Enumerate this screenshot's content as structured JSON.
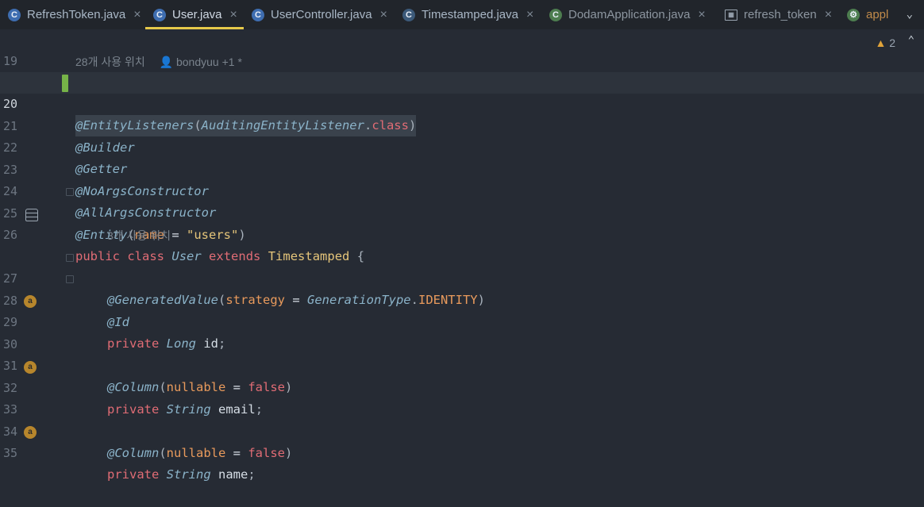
{
  "tabs": [
    {
      "label": "RefreshToken.java",
      "icon": "class-icon",
      "icon_glyph": "C",
      "active": false
    },
    {
      "label": "User.java",
      "icon": "class-icon",
      "icon_glyph": "C",
      "active": true
    },
    {
      "label": "UserController.java",
      "icon": "class-icon",
      "icon_glyph": "C",
      "active": false
    },
    {
      "label": "Timestamped.java",
      "icon": "abstract-class-icon",
      "icon_glyph": "C",
      "active": false
    },
    {
      "label": "DodamApplication.java",
      "icon": "spring-boot-class-icon",
      "icon_glyph": "C",
      "active": false
    },
    {
      "label": "refresh_token",
      "icon": "table-icon",
      "icon_glyph": "▦",
      "active": false
    },
    {
      "label": "appl",
      "icon": "spring-boot-icon",
      "icon_glyph": "⚙",
      "active": false
    }
  ],
  "close_glyph": "×",
  "more_glyph": "⌄",
  "inspections": {
    "warning_count": "2",
    "warning_glyph": "▲",
    "up_glyph": "⌃"
  },
  "hints": {
    "class_usages": "28개 사용 위치",
    "author": "bondyuu +1 *",
    "field_usages": "3개 사용 위치"
  },
  "line_numbers": [
    "19",
    "20",
    "21",
    "22",
    "23",
    "24",
    "25",
    "26",
    "27",
    "28",
    "29",
    "30",
    "31",
    "32",
    "33",
    "34",
    "35"
  ],
  "code": {
    "l20_a": "@EntityListeners",
    "l20_b": "(",
    "l20_c": "AuditingEntityListener",
    "l20_d": ".",
    "l20_e": "class",
    "l20_f": ")",
    "l21": "@Builder",
    "l22": "@Getter",
    "l23": "@NoArgsConstructor",
    "l24": "@AllArgsConstructor",
    "l25_a": "@Entity",
    "l25_b": "(",
    "l25_c": "name",
    "l25_d": " = ",
    "l25_e": "\"users\"",
    "l25_f": ")",
    "l26_a": "public",
    "l26_b": "class",
    "l26_c": "User",
    "l26_d": "extends",
    "l26_e": "Timestamped",
    "l26_f": "{",
    "l27_a": "@GeneratedValue",
    "l27_b": "(",
    "l27_c": "strategy",
    "l27_d": " = ",
    "l27_e": "GenerationType",
    "l27_f": ".",
    "l27_g": "IDENTITY",
    "l27_h": ")",
    "l28": "@Id",
    "l29_a": "private",
    "l29_b": "Long",
    "l29_c": "id",
    "l29_d": ";",
    "l31_a": "@Column",
    "l31_b": "(",
    "l31_c": "nullable",
    "l31_d": " = ",
    "l31_e": "false",
    "l31_f": ")",
    "l32_a": "private",
    "l32_b": "String",
    "l32_c": "email",
    "l32_d": ";",
    "l34_a": "@Column",
    "l34_b": "(",
    "l34_c": "nullable",
    "l34_d": " = ",
    "l34_e": "false",
    "l34_f": ")",
    "l35_a": "private",
    "l35_b": "String",
    "l35_c": "name",
    "l35_d": ";"
  },
  "gutter_icons": {
    "field_icon_glyph": "a",
    "field_key_glyph": "a"
  },
  "colors": {
    "background": "#262b34",
    "tab_active_underline": "#e6c94a",
    "keyword": "#e06c75",
    "annotation": "#8bb3c9",
    "string": "#e5c57a",
    "change_marker": "#76b348"
  }
}
